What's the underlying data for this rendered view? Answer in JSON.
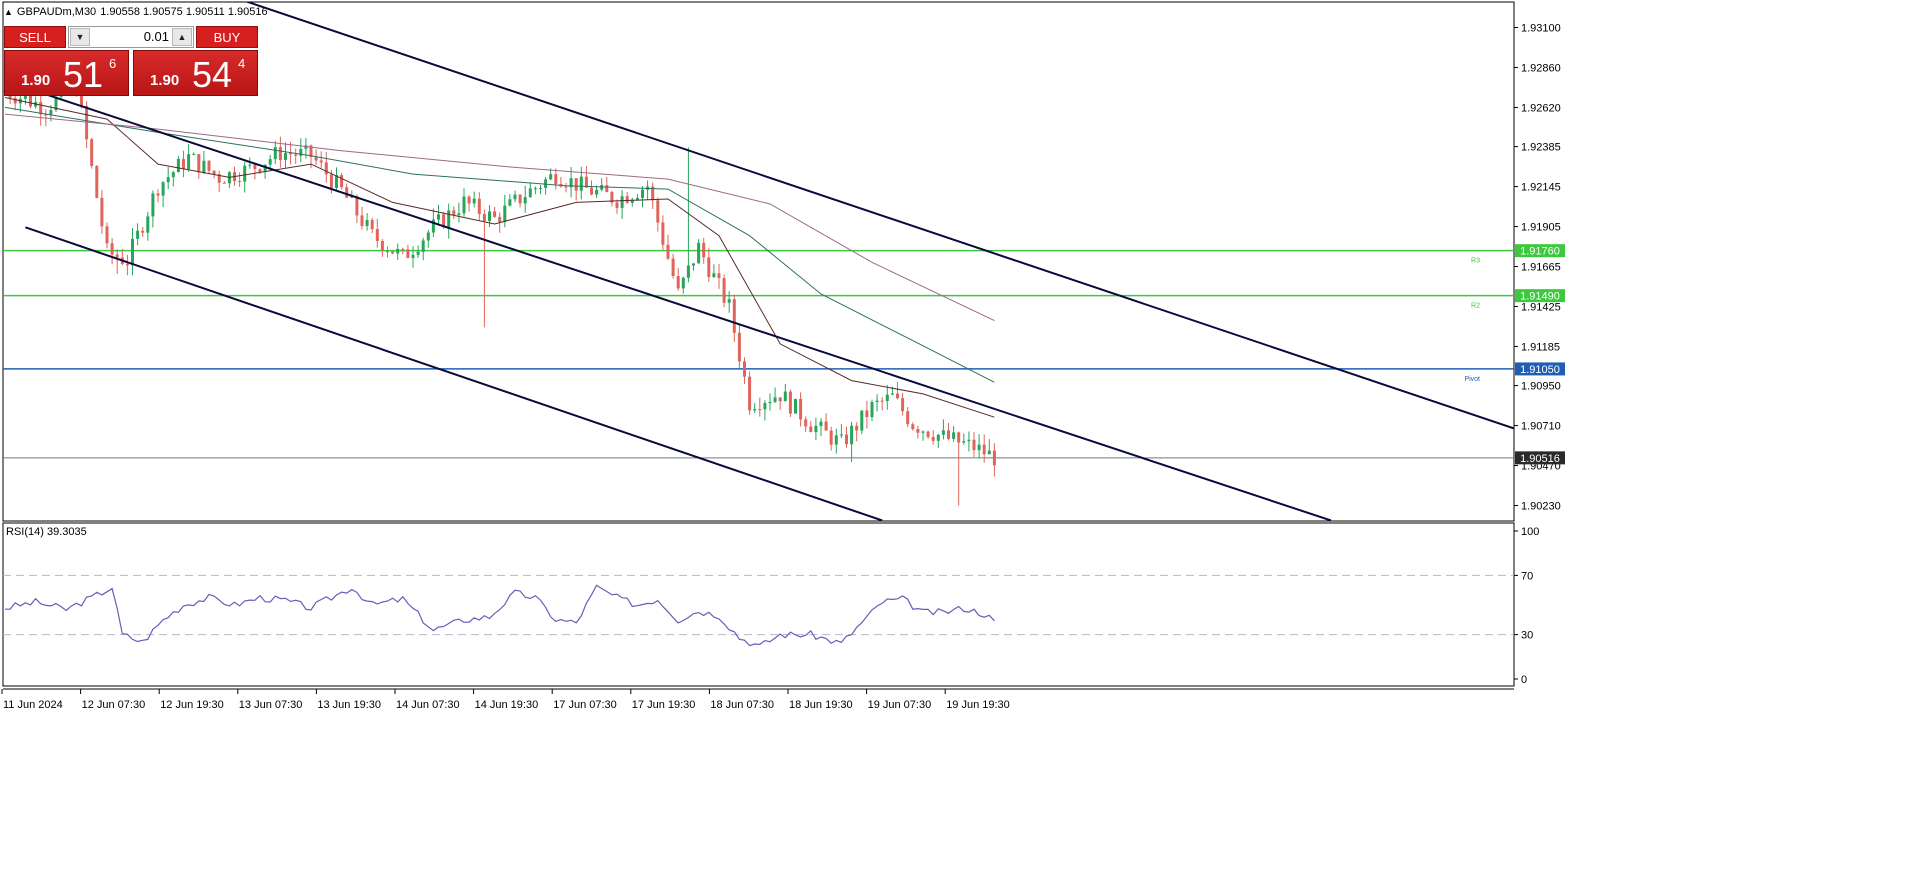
{
  "header": {
    "symbol_timeframe": "GBPAUDm,M30",
    "ohlc": "1.90558 1.90575 1.90511 1.90516",
    "collapse_icon": "triangle-up-icon"
  },
  "trade_panel": {
    "sell_label": "SELL",
    "buy_label": "BUY",
    "lot_value": "0.01",
    "down_icon": "arrow-down-icon",
    "up_icon": "arrow-up-icon",
    "sell_price": {
      "small": "1.90",
      "big": "51",
      "sup": "6"
    },
    "buy_price": {
      "small": "1.90",
      "big": "54",
      "sup": "4"
    }
  },
  "colors": {
    "bull": "#26a65b",
    "bear": "#e0645a",
    "channel": "#0a0a3c",
    "resistance": "#3cc93c",
    "pivot": "#1e5fb4",
    "current": "#6e7b82",
    "rsi": "#6b5bb8",
    "ma_fast": "#5a2a2a",
    "ma_mid": "#2f7060",
    "ma_slow": "#9a6a8a"
  },
  "chart_data": {
    "type": "candlestick",
    "symbol": "GBPAUDm",
    "timeframe": "M30",
    "y_ticks": [
      1.931,
      1.9286,
      1.9262,
      1.92385,
      1.92145,
      1.91905,
      1.91665,
      1.91425,
      1.91185,
      1.9095,
      1.9071,
      1.9047,
      1.9023
    ],
    "y_tick_labels": [
      "1.93100",
      "1.92860",
      "1.92620",
      "1.92385",
      "1.92145",
      "1.91905",
      "1.91665",
      "1.91425",
      "1.91185",
      "1.90950",
      "1.90710",
      "1.90470",
      "1.90230"
    ],
    "ylim": [
      1.9014,
      1.9327
    ],
    "x_labels": [
      "11 Jun 2024",
      "12 Jun 07:30",
      "12 Jun 19:30",
      "13 Jun 07:30",
      "13 Jun 19:30",
      "14 Jun 07:30",
      "14 Jun 19:30",
      "17 Jun 07:30",
      "17 Jun 19:30",
      "18 Jun 07:30",
      "18 Jun 19:30",
      "19 Jun 07:30",
      "19 Jun 19:30"
    ],
    "price_path": [
      {
        "bar": 0,
        "price": 1.9272
      },
      {
        "bar": 8,
        "price": 1.9262
      },
      {
        "bar": 14,
        "price": 1.9275
      },
      {
        "bar": 20,
        "price": 1.9175
      },
      {
        "bar": 24,
        "price": 1.917
      },
      {
        "bar": 30,
        "price": 1.9215
      },
      {
        "bar": 36,
        "price": 1.9232
      },
      {
        "bar": 42,
        "price": 1.922
      },
      {
        "bar": 48,
        "price": 1.9225
      },
      {
        "bar": 54,
        "price": 1.9235
      },
      {
        "bar": 60,
        "price": 1.9233
      },
      {
        "bar": 66,
        "price": 1.9212
      },
      {
        "bar": 72,
        "price": 1.9185
      },
      {
        "bar": 78,
        "price": 1.9172
      },
      {
        "bar": 84,
        "price": 1.919
      },
      {
        "bar": 90,
        "price": 1.9205
      },
      {
        "bar": 96,
        "price": 1.9195
      },
      {
        "bar": 102,
        "price": 1.921
      },
      {
        "bar": 108,
        "price": 1.9222
      },
      {
        "bar": 114,
        "price": 1.9213
      },
      {
        "bar": 120,
        "price": 1.9207
      },
      {
        "bar": 126,
        "price": 1.9215
      },
      {
        "bar": 132,
        "price": 1.915
      },
      {
        "bar": 136,
        "price": 1.9178
      },
      {
        "bar": 142,
        "price": 1.9142
      },
      {
        "bar": 146,
        "price": 1.9085
      },
      {
        "bar": 152,
        "price": 1.909
      },
      {
        "bar": 158,
        "price": 1.9072
      },
      {
        "bar": 164,
        "price": 1.906
      },
      {
        "bar": 170,
        "price": 1.9082
      },
      {
        "bar": 174,
        "price": 1.9088
      },
      {
        "bar": 178,
        "price": 1.9072
      },
      {
        "bar": 184,
        "price": 1.9064
      },
      {
        "bar": 190,
        "price": 1.9058
      },
      {
        "bar": 194,
        "price": 1.9052
      }
    ],
    "spikes": [
      {
        "bar": 22,
        "low": 1.9162
      },
      {
        "bar": 94,
        "low": 1.913
      },
      {
        "bar": 134,
        "high": 1.9238
      },
      {
        "bar": 166,
        "low": 1.9049
      },
      {
        "bar": 187,
        "low": 1.9023
      }
    ],
    "moving_averages": [
      {
        "id": "fast",
        "points": [
          {
            "bar": 0,
            "price": 1.9268
          },
          {
            "bar": 20,
            "price": 1.9255
          },
          {
            "bar": 30,
            "price": 1.9228
          },
          {
            "bar": 44,
            "price": 1.922
          },
          {
            "bar": 60,
            "price": 1.9228
          },
          {
            "bar": 76,
            "price": 1.9205
          },
          {
            "bar": 96,
            "price": 1.9192
          },
          {
            "bar": 112,
            "price": 1.9205
          },
          {
            "bar": 130,
            "price": 1.9207
          },
          {
            "bar": 140,
            "price": 1.9185
          },
          {
            "bar": 152,
            "price": 1.912
          },
          {
            "bar": 166,
            "price": 1.9098
          },
          {
            "bar": 180,
            "price": 1.909
          },
          {
            "bar": 194,
            "price": 1.9076
          }
        ]
      },
      {
        "id": "mid",
        "points": [
          {
            "bar": 0,
            "price": 1.9262
          },
          {
            "bar": 30,
            "price": 1.9247
          },
          {
            "bar": 60,
            "price": 1.9233
          },
          {
            "bar": 80,
            "price": 1.9222
          },
          {
            "bar": 110,
            "price": 1.9215
          },
          {
            "bar": 130,
            "price": 1.9213
          },
          {
            "bar": 146,
            "price": 1.9185
          },
          {
            "bar": 160,
            "price": 1.915
          },
          {
            "bar": 178,
            "price": 1.9122
          },
          {
            "bar": 194,
            "price": 1.9097
          }
        ]
      },
      {
        "id": "slow",
        "points": [
          {
            "bar": 0,
            "price": 1.9258
          },
          {
            "bar": 30,
            "price": 1.9249
          },
          {
            "bar": 66,
            "price": 1.9236
          },
          {
            "bar": 100,
            "price": 1.9226
          },
          {
            "bar": 130,
            "price": 1.9219
          },
          {
            "bar": 150,
            "price": 1.9204
          },
          {
            "bar": 170,
            "price": 1.9169
          },
          {
            "bar": 194,
            "price": 1.9134
          }
        ]
      }
    ],
    "channel_lines": [
      {
        "from": {
          "bar": 46,
          "price": 1.9327
        },
        "to": {
          "bar": 300,
          "price": 1.9065
        }
      },
      {
        "from": {
          "bar": 0,
          "price": 1.9278
        },
        "to": {
          "bar": 260,
          "price": 1.9014
        }
      },
      {
        "from": {
          "bar": 4,
          "price": 1.919
        },
        "to": {
          "bar": 172,
          "price": 1.9014
        }
      }
    ],
    "horizontal_levels": [
      {
        "price": 1.9176,
        "label": "1.91760",
        "tag": "R3",
        "kind": "resistance"
      },
      {
        "price": 1.9149,
        "label": "1.91490",
        "tag": "R2",
        "kind": "resistance"
      },
      {
        "price": 1.9105,
        "label": "1.91050",
        "tag": "Pivot",
        "kind": "pivot"
      },
      {
        "price": 1.90516,
        "label": "1.90516",
        "tag": "",
        "kind": "current"
      }
    ],
    "rsi": {
      "label": "RSI(14) 39.3035",
      "period": 14,
      "ylim": [
        0,
        100
      ],
      "levels": [
        70,
        30
      ],
      "y_tick_labels": [
        "100",
        "70",
        "30",
        "0"
      ],
      "points": [
        {
          "bar": 0,
          "value": 48
        },
        {
          "bar": 6,
          "value": 52
        },
        {
          "bar": 12,
          "value": 47
        },
        {
          "bar": 17,
          "value": 55
        },
        {
          "bar": 21,
          "value": 62
        },
        {
          "bar": 23,
          "value": 30
        },
        {
          "bar": 27,
          "value": 25
        },
        {
          "bar": 31,
          "value": 40
        },
        {
          "bar": 35,
          "value": 50
        },
        {
          "bar": 40,
          "value": 55
        },
        {
          "bar": 45,
          "value": 50
        },
        {
          "bar": 50,
          "value": 55
        },
        {
          "bar": 55,
          "value": 53
        },
        {
          "bar": 60,
          "value": 48
        },
        {
          "bar": 64,
          "value": 55
        },
        {
          "bar": 68,
          "value": 62
        },
        {
          "bar": 72,
          "value": 50
        },
        {
          "bar": 78,
          "value": 54
        },
        {
          "bar": 84,
          "value": 33
        },
        {
          "bar": 90,
          "value": 40
        },
        {
          "bar": 95,
          "value": 42
        },
        {
          "bar": 100,
          "value": 58
        },
        {
          "bar": 104,
          "value": 55
        },
        {
          "bar": 108,
          "value": 40
        },
        {
          "bar": 112,
          "value": 38
        },
        {
          "bar": 116,
          "value": 62
        },
        {
          "bar": 120,
          "value": 55
        },
        {
          "bar": 124,
          "value": 50
        },
        {
          "bar": 128,
          "value": 54
        },
        {
          "bar": 132,
          "value": 40
        },
        {
          "bar": 136,
          "value": 46
        },
        {
          "bar": 140,
          "value": 43
        },
        {
          "bar": 144,
          "value": 28
        },
        {
          "bar": 148,
          "value": 22
        },
        {
          "bar": 152,
          "value": 30
        },
        {
          "bar": 158,
          "value": 30
        },
        {
          "bar": 164,
          "value": 24
        },
        {
          "bar": 168,
          "value": 38
        },
        {
          "bar": 172,
          "value": 52
        },
        {
          "bar": 176,
          "value": 54
        },
        {
          "bar": 180,
          "value": 45
        },
        {
          "bar": 184,
          "value": 45
        },
        {
          "bar": 188,
          "value": 48
        },
        {
          "bar": 192,
          "value": 44
        },
        {
          "bar": 194,
          "value": 39.3
        }
      ]
    }
  }
}
